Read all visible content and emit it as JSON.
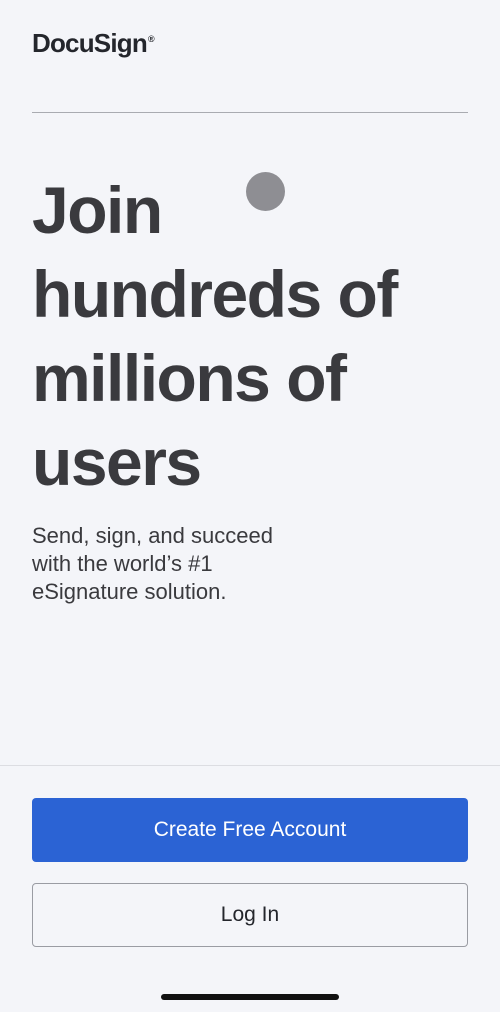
{
  "brand": {
    "name": "DocuSign",
    "mark": "®"
  },
  "hero": {
    "headline_lines": [
      "Join",
      "hundreds of",
      "millions of",
      "users"
    ],
    "subtitle_lines": [
      "Send, sign, and succeed",
      "with the world’s #1",
      "eSignature solution."
    ]
  },
  "actions": {
    "create_account_label": "Create Free Account",
    "login_label": "Log In"
  },
  "colors": {
    "background": "#f4f5f9",
    "primary_button": "#2b63d4",
    "text": "#3a3a3e"
  }
}
